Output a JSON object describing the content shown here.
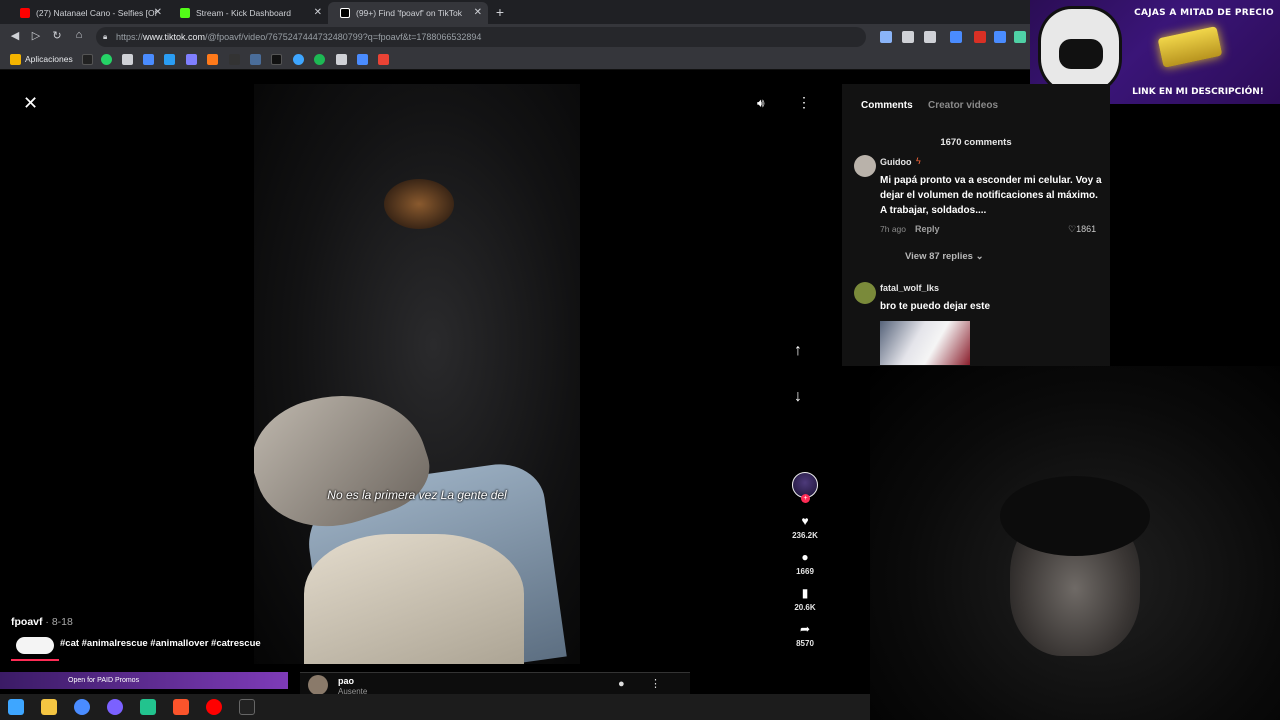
{
  "browser": {
    "tabs": [
      {
        "title": "(27) Natanael Cano - Selfies [Of",
        "favicon_color": "#ff0000"
      },
      {
        "title": "Stream - Kick Dashboard",
        "favicon_color": "#53fc18"
      },
      {
        "title": "(99+) Find 'fpoavf' on TikTok",
        "favicon_color": "#ffffff"
      }
    ],
    "url_prefix": "https://",
    "url_host": "www.tiktok.com",
    "url_path": "/@fpoavf/video/7675247444732480799?q=fpoavf&t=1788066532894",
    "bookmarks_label": "Aplicaciones"
  },
  "ad": {
    "title": "CAJAS A MITAD DE PRECIO",
    "subtitle": "LINK EN MI DESCRIPCIÓN!"
  },
  "video": {
    "subtitle": "No es la primera vez La gente del",
    "author": "fpoavf",
    "date": " · 8-18",
    "hashtags": "#cat #animalrescue #animallover #catrescue",
    "likes": "236.2K",
    "comments": "1669",
    "saves": "20.6K",
    "shares": "8570"
  },
  "comments_panel": {
    "tab_comments": "Comments",
    "tab_creator": "Creator videos",
    "count": "1670 comments",
    "items": [
      {
        "user": "Guidoo",
        "text": "Mi papá pronto va a esconder mi celular. Voy a dejar el volumen de notificaciones al máximo. A trabajar, soldados....",
        "time": "7h ago",
        "reply": "Reply",
        "likes": "1861",
        "view_replies": "View 87 replies"
      },
      {
        "user": "fatal_wolf_lks",
        "text": "bro te puedo dejar este"
      }
    ]
  },
  "stream": {
    "banner": "Open for PAID Promos",
    "user": "pao",
    "status": "Ausente"
  },
  "colors": {
    "accent": "#fe2c55",
    "panel_bg": "#121212",
    "browser_bg": "#35363b"
  }
}
